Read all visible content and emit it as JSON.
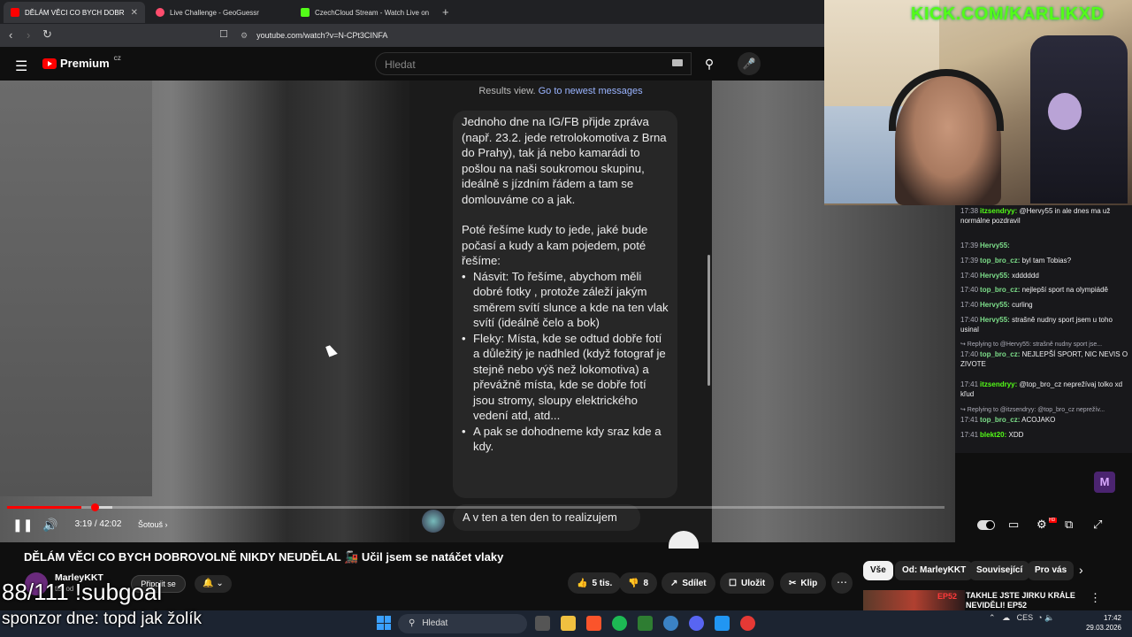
{
  "browser": {
    "tabs": [
      {
        "label": "DĚLÁM VĚCI CO BYCH DOBR",
        "favicon_color": "#ff0000",
        "active": true
      },
      {
        "label": "Live Challenge - GeoGuessr",
        "favicon_color": "#ff4d6d",
        "active": false
      },
      {
        "label": "CzechCloud Stream - Watch Live on",
        "favicon_color": "#53fc18",
        "active": false
      }
    ],
    "new_tab": "+",
    "close_tab": "✕",
    "url": "youtube.com/watch?v=N-CPt3CINFA"
  },
  "youtube": {
    "logo_text": "Premium",
    "region": "CZ",
    "search_placeholder": "Hledat"
  },
  "video": {
    "overlay_text_prefix": "Results view. ",
    "overlay_link": "Go to newest messages",
    "message_p1": "Jednoho dne na IG/FB přijde zpráva (např. 23.2. jede retrolokomotiva z Brna do Prahy), tak já nebo kamarádi to pošlou na naši soukromou skupinu, ideálně s jízdním řádem a tam se domlouváme co a jak.",
    "message_p2": "Poté řešíme kudy to jede, jaké bude počasí a kudy a kam pojedem, poté řešíme:",
    "bullets": [
      "Násvit: To řešíme, abychom měli dobré fotky , protože záleží jakým směrem svítí slunce a kde na ten vlak svítí (ideálně čelo a bok)",
      "Fleky: Místa, kde se odtud dobře fotí a důležitý je nadhled (když fotograf je stejně nebo výš než lokomotiva) a převážně místa, kde se dobře fotí jsou stromy, sloupy elektrického vedení atd, atd...",
      "A pak se dohodneme kdy sraz kde a kdy."
    ],
    "message2": "A v ten a ten den to realizujem"
  },
  "player": {
    "time": "3:19 / 42:02",
    "chapter": "Šotouš",
    "chapter_arrow": "›",
    "progress_fraction": 0.079,
    "hd_badge": "HD"
  },
  "meta": {
    "title": "DĚLÁM VĚCI CO BYCH DOBROVOLNĚ NIKDY NEUDĚLAL 🚂 Učil jsem se natáčet vlaky",
    "channel": "MarleyKKT",
    "subs": "tis. od",
    "join": "Připojit se",
    "likes": "5 tis.",
    "dislikes": "8",
    "share": "Sdílet",
    "save": "Uložit",
    "clip": "Klip",
    "more": "⋯"
  },
  "chips": [
    "Vše",
    "Od: MarleyKKT",
    "Související",
    "Pro vás"
  ],
  "recommendation": {
    "title": "TAKHLE JSTE JIRKU KRÁLE NEVIDĚLI! EP52",
    "thumb_text": "EP52"
  },
  "overlay": {
    "subgoal": "88/111 !subgoal",
    "sponsor": "sponzor dne: topd jak žolík",
    "kick": "KICK.COM/KARLIKXD"
  },
  "chat": [
    {
      "time": "17:38",
      "name": "itzsendryy:",
      "name_color": "#53fc18",
      "text": "@Hervy55 in ale dnes ma už normálne pozdravil",
      "reply": ""
    },
    {
      "time": "17:39",
      "name": "Hervy55:",
      "name_color": "#7ddf8a",
      "text": "",
      "reply": ""
    },
    {
      "time": "17:39",
      "name": "top_bro_cz:",
      "name_color": "#7ddf8a",
      "text": "byl tam Tobias?",
      "reply": ""
    },
    {
      "time": "17:40",
      "name": "Hervy55:",
      "name_color": "#7ddf8a",
      "text": "xdddddd",
      "reply": ""
    },
    {
      "time": "17:40",
      "name": "top_bro_cz:",
      "name_color": "#7ddf8a",
      "text": "nejlepší sport na olympiádě",
      "reply": ""
    },
    {
      "time": "17:40",
      "name": "Hervy55:",
      "name_color": "#7ddf8a",
      "text": "curling",
      "reply": ""
    },
    {
      "time": "17:40",
      "name": "Hervy55:",
      "name_color": "#7ddf8a",
      "text": "strašně nudny sport jsem u toho usinal",
      "reply": ""
    },
    {
      "time": "17:40",
      "name": "top_bro_cz:",
      "name_color": "#7ddf8a",
      "text": "NEJLEPŠÍ SPORT, NIC NEVIS O ZIVOTE",
      "reply": "Replying to @Hervy55: strašně nudny sport jse..."
    },
    {
      "time": "17:41",
      "name": "itzsendryy:",
      "name_color": "#53fc18",
      "text": "@top_bro_cz neprežívaj tolko xd kľud",
      "reply": ""
    },
    {
      "time": "17:41",
      "name": "top_bro_cz:",
      "name_color": "#7ddf8a",
      "text": "ACOJAKO",
      "reply": "Replying to @itzsendryy: @top_bro_cz neprežív..."
    },
    {
      "time": "17:41",
      "name": "blekt20:",
      "name_color": "#53fc18",
      "text": "XDD",
      "reply": ""
    }
  ],
  "taskbar": {
    "search": "Hledat",
    "lang": "CES",
    "time": "17:42",
    "date": "29.03.2026"
  }
}
